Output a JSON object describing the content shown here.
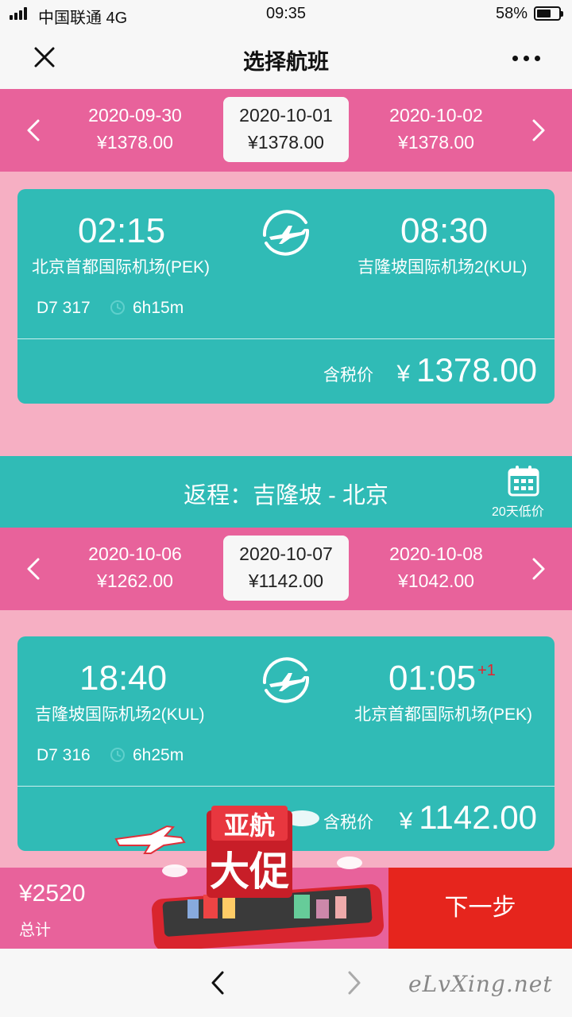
{
  "status": {
    "carrier": "中国联通 4G",
    "time": "09:35",
    "battery": "58%"
  },
  "nav": {
    "title": "选择航班"
  },
  "outbound": {
    "dates": [
      {
        "date": "2020-09-30",
        "price": "¥1378.00"
      },
      {
        "date": "2020-10-01",
        "price": "¥1378.00",
        "selected": true
      },
      {
        "date": "2020-10-02",
        "price": "¥1378.00"
      }
    ],
    "flight": {
      "dep_time": "02:15",
      "dep_airport": "北京首都国际机场(PEK)",
      "arr_time": "08:30",
      "arr_airport": "吉隆坡国际机场2(KUL)",
      "flight_no": "D7 317",
      "duration": "6h15m",
      "price_label": "含税价",
      "currency": "¥",
      "price": "1378.00"
    }
  },
  "return_bar": {
    "label": "返程：吉隆坡 - 北京",
    "calendar_label": "20天低价",
    "calendar_icon": "calendar-icon"
  },
  "inbound": {
    "dates": [
      {
        "date": "2020-10-06",
        "price": "¥1262.00"
      },
      {
        "date": "2020-10-07",
        "price": "¥1142.00",
        "selected": true
      },
      {
        "date": "2020-10-08",
        "price": "¥1042.00"
      }
    ],
    "flight": {
      "dep_time": "18:40",
      "dep_airport": "吉隆坡国际机场2(KUL)",
      "arr_time": "01:05",
      "arr_plus": "+1",
      "arr_airport": "北京首都国际机场(PEK)",
      "flight_no": "D7 316",
      "duration": "6h25m",
      "price_label": "含税价",
      "currency": "¥",
      "price": "1142.00"
    }
  },
  "footer": {
    "total": "¥2520",
    "total_label": "总计",
    "next_label": "下一步"
  },
  "promo": {
    "line1": "亚航",
    "line2": "大促"
  },
  "watermark": "eLvXing.net",
  "colors": {
    "teal": "#30bbb6",
    "pink": "#e8629b",
    "light_pink": "#f6afc3",
    "red": "#e6251d"
  }
}
